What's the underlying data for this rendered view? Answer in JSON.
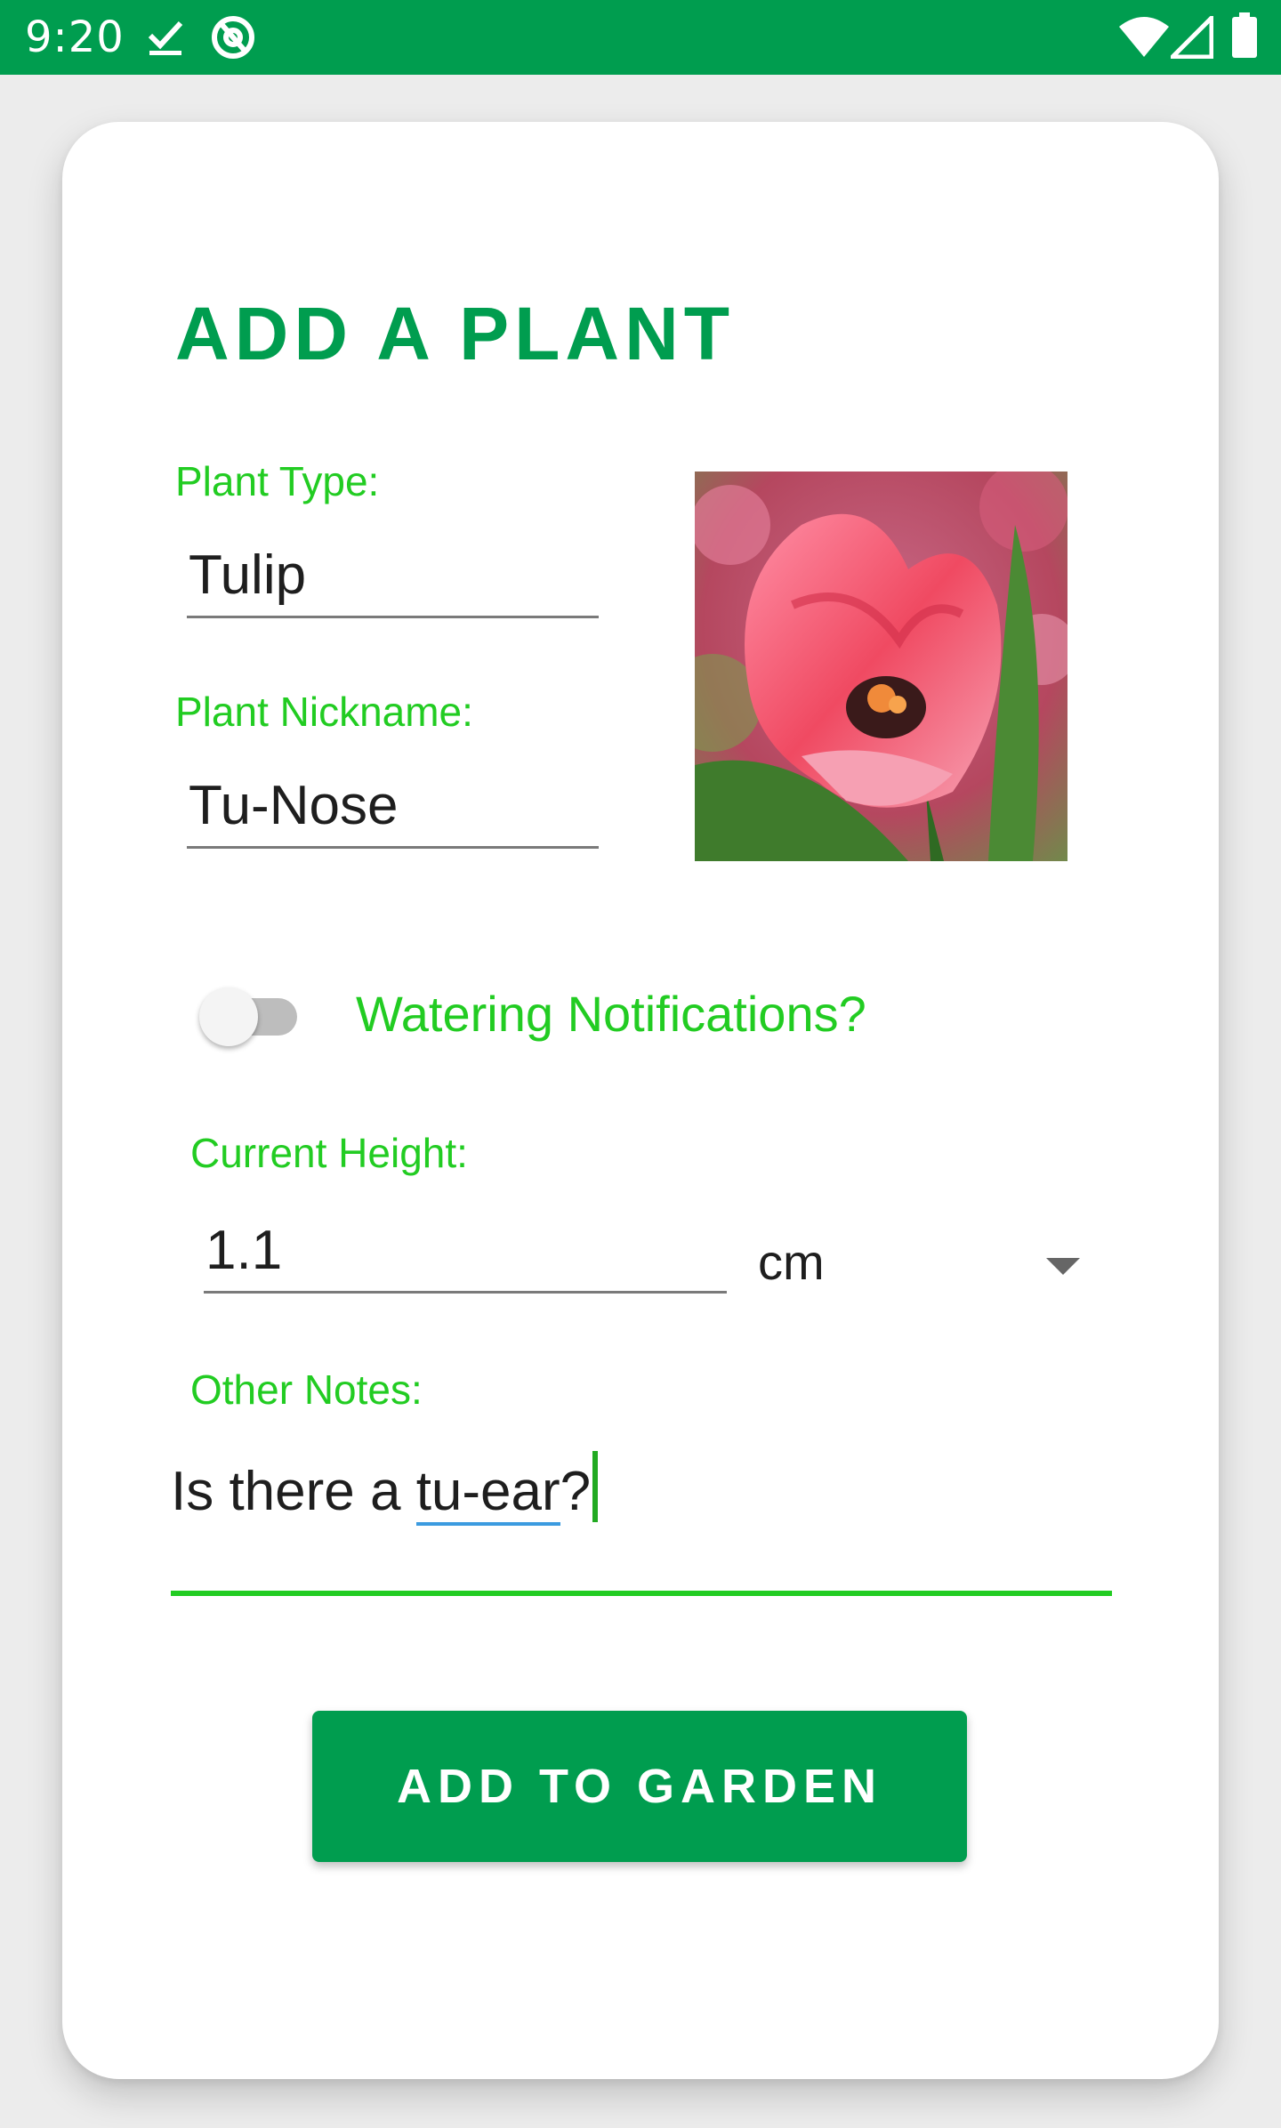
{
  "status_bar": {
    "time": "9:20",
    "left_icons": [
      "check-download-icon",
      "at-sign-icon"
    ],
    "right_icons": [
      "wifi-icon",
      "cell-signal-icon",
      "battery-icon"
    ],
    "color": "#009d4f"
  },
  "form": {
    "title": "ADD A PLANT",
    "plant_type": {
      "label": "Plant Type:",
      "value": "Tulip"
    },
    "nickname": {
      "label": "Plant Nickname:",
      "value": "Tu-Nose"
    },
    "photo": {
      "icon": "tulip-photo"
    },
    "notifications": {
      "label": "Watering Notifications?",
      "enabled": false
    },
    "height": {
      "label": "Current Height:",
      "value": "1.1",
      "unit": "cm"
    },
    "notes": {
      "label": "Other Notes:",
      "prefix": "Is there a ",
      "misspelled": "tu-ear",
      "suffix": "?"
    },
    "submit_label": "ADD TO GARDEN"
  },
  "colors": {
    "primary": "#009d4f",
    "accent_label": "#22cc22",
    "spellcheck": "#3b9be0"
  }
}
